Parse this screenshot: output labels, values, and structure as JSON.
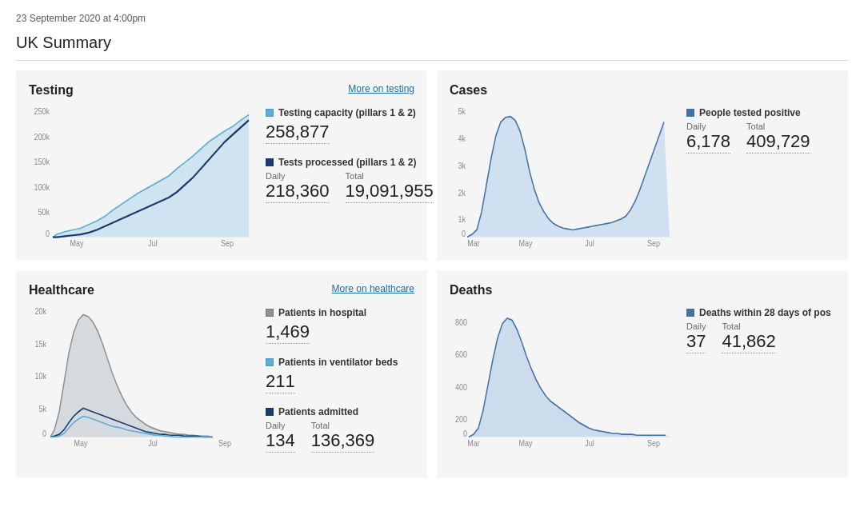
{
  "timestamp": "23 September 2020 at 4:00pm",
  "page_title": "UK Summary",
  "testing": {
    "title": "Testing",
    "link": "More on testing",
    "capacity_label": "Testing capacity (pillars 1 & 2)",
    "capacity_value": "258,877",
    "processed_label": "Tests processed (pillars 1 & 2)",
    "processed_daily_header": "Daily",
    "processed_total_header": "Total",
    "processed_daily": "218,360",
    "processed_total": "19,091,955",
    "x_labels": [
      "May",
      "Jul",
      "Sep"
    ],
    "y_labels": [
      "250k",
      "200k",
      "150k",
      "100k",
      "50k",
      "0"
    ]
  },
  "cases": {
    "title": "Cases",
    "positive_label": "People tested positive",
    "daily_header": "Daily",
    "total_header": "Total",
    "daily_value": "6,178",
    "total_value": "409,729",
    "x_labels": [
      "Mar",
      "May",
      "Jul",
      "Sep"
    ],
    "y_labels": [
      "5k",
      "4k",
      "3k",
      "2k",
      "1k",
      "0"
    ]
  },
  "healthcare": {
    "title": "Healthcare",
    "link": "More on healthcare",
    "hospital_label": "Patients in hospital",
    "hospital_value": "1,469",
    "ventilator_label": "Patients in ventilator beds",
    "ventilator_value": "211",
    "admitted_label": "Patients admitted",
    "admitted_daily_header": "Daily",
    "admitted_total_header": "Total",
    "admitted_daily": "134",
    "admitted_total": "136,369",
    "x_labels": [
      "May",
      "Jul",
      "Sep"
    ],
    "y_labels": [
      "20k",
      "15k",
      "10k",
      "5k",
      "0"
    ]
  },
  "deaths": {
    "title": "Deaths",
    "deaths_label": "Deaths within 28 days of pos",
    "daily_header": "Daily",
    "total_header": "Total",
    "daily_value": "37",
    "total_value": "41,862",
    "x_labels": [
      "Mar",
      "May",
      "Jul",
      "Sep"
    ],
    "y_labels": [
      "800",
      "600",
      "400",
      "200",
      "0"
    ]
  },
  "colors": {
    "light_blue": "#5baed6",
    "dark_blue": "#1a4a7a",
    "mid_blue": "#4272a4",
    "gray": "#a0a0a0",
    "link_blue": "#1a6da3",
    "chart_fill": "#c8dff0",
    "chart_fill2": "#d0d8e0"
  }
}
